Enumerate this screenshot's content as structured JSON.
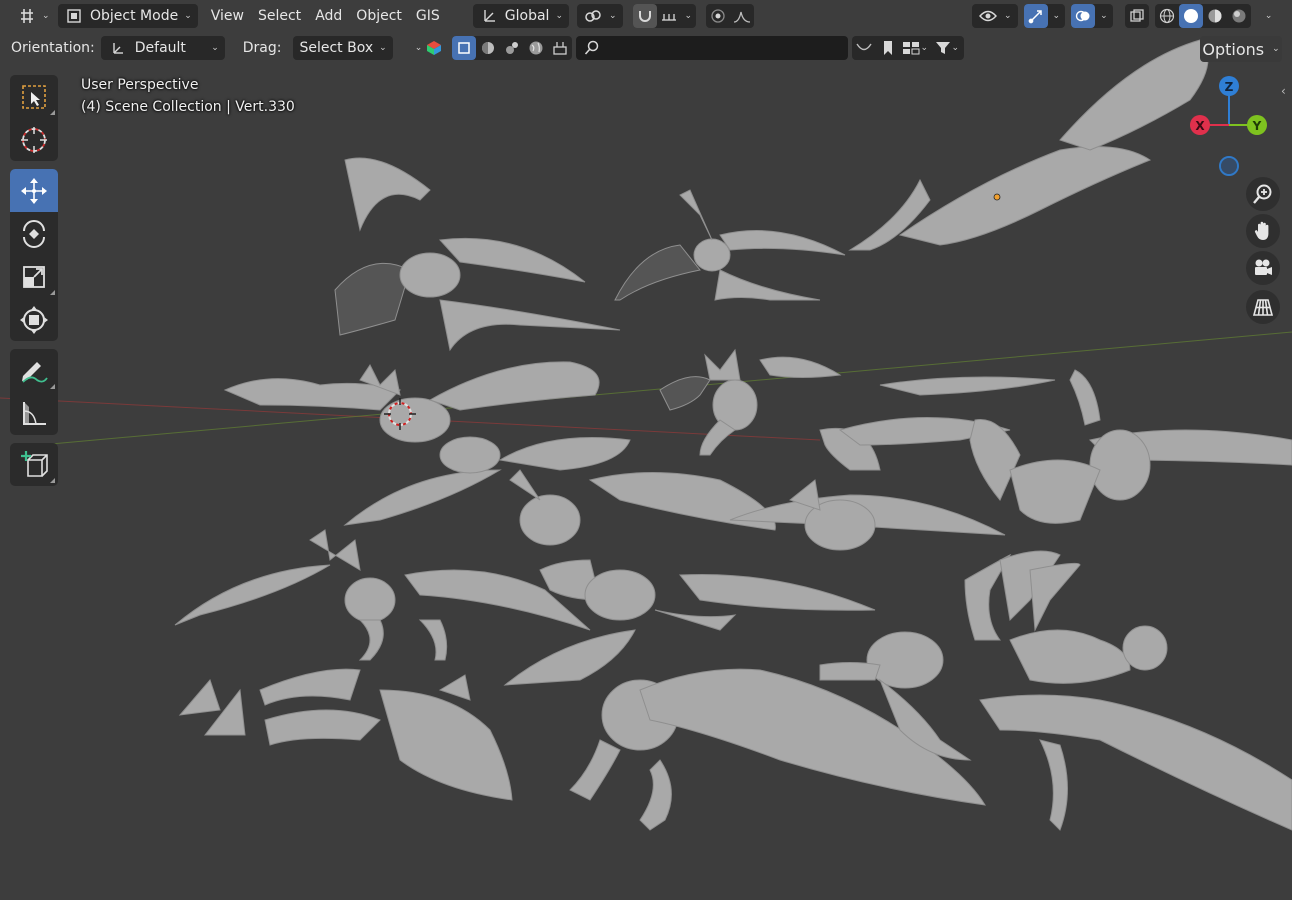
{
  "header": {
    "mode_label": "Object Mode",
    "menus": [
      "View",
      "Select",
      "Add",
      "Object",
      "GIS"
    ],
    "transform_orientation": "Global"
  },
  "tool_settings": {
    "orientation_label": "Orientation:",
    "orientation_value": "Default",
    "drag_label": "Drag:",
    "drag_value": "Select Box",
    "search_placeholder": "",
    "options_label": "Options"
  },
  "viewport": {
    "perspective_label": "User Perspective",
    "collection_info": "(4) Scene Collection | Vert.330"
  },
  "gizmo": {
    "axis_x": "X",
    "axis_y": "Y",
    "axis_z": "Z",
    "color_x": "#e0304c",
    "color_y": "#7ec21f",
    "color_z": "#2f7fd6"
  },
  "colors": {
    "accent": "#4772b3",
    "background": "#3d3d3d",
    "panel": "#282828"
  },
  "toolbar": {
    "tools": [
      "select-box",
      "cursor",
      "move",
      "rotate",
      "scale",
      "transform",
      "annotate",
      "measure",
      "add-cube"
    ],
    "active_tool": "move"
  }
}
